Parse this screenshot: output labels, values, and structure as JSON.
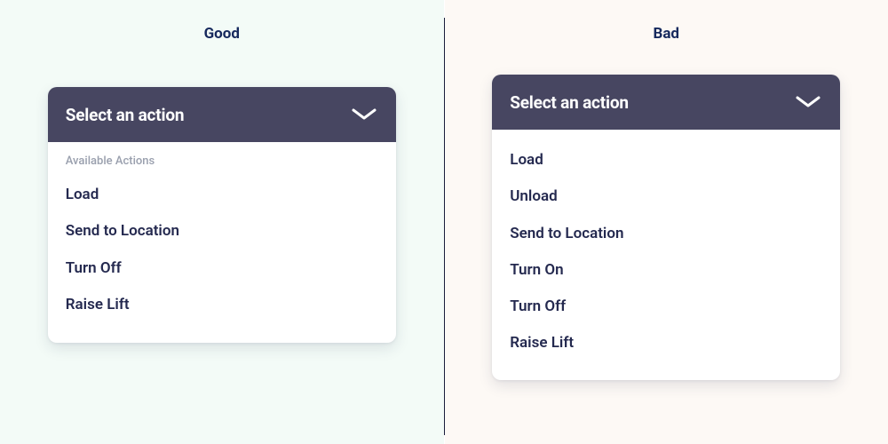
{
  "left": {
    "title": "Good",
    "dropdown": {
      "header": "Select an action",
      "section_label": "Available Actions",
      "options": [
        "Load",
        "Send to Location",
        "Turn Off",
        "Raise Lift"
      ]
    }
  },
  "right": {
    "title": "Bad",
    "dropdown": {
      "header": "Select an action",
      "options": [
        "Load",
        "Unload",
        "Send to Location",
        "Turn On",
        "Turn Off",
        "Raise Lift"
      ]
    }
  }
}
